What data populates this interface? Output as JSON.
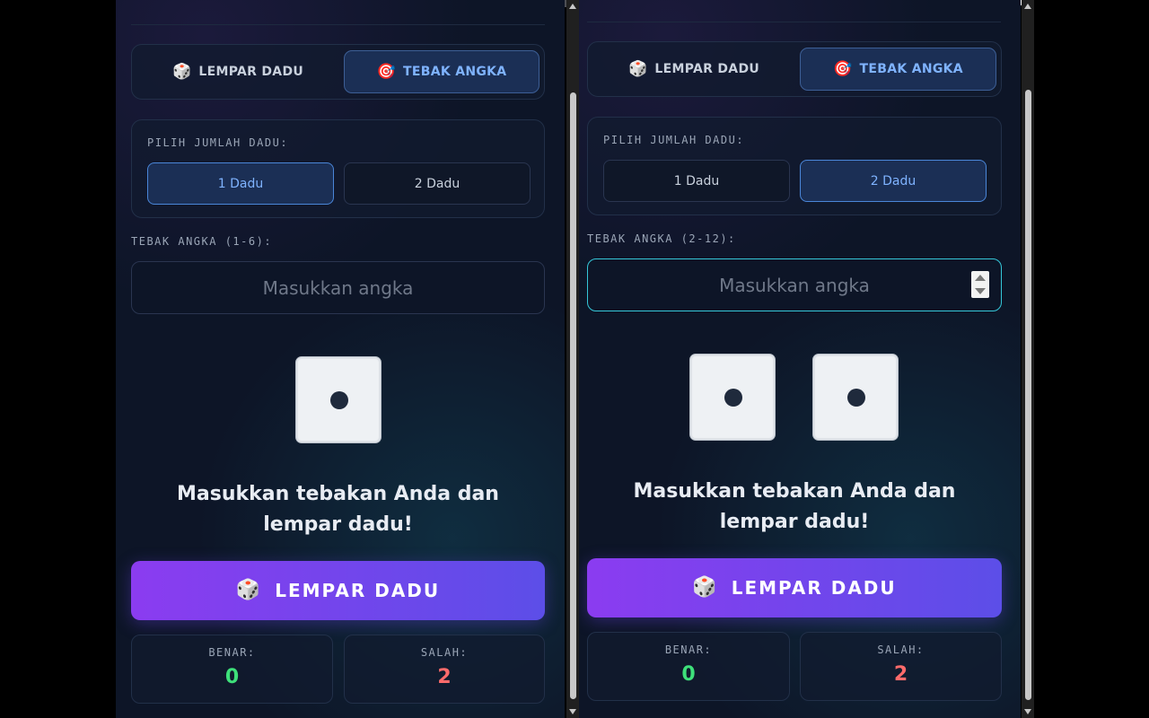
{
  "icons": {
    "dice": "🎲",
    "target": "🎯"
  },
  "colors": {
    "accent_blue": "#7fb3ff",
    "correct": "#3ee07a",
    "wrong": "#ff6b6b",
    "roll_gradient_start": "#8b3cf0",
    "roll_gradient_end": "#5c4ee8"
  },
  "left": {
    "modes": {
      "roll_label": "LEMPAR DADU",
      "guess_label": "TEBAK ANGKA",
      "active": "guess"
    },
    "dice_count": {
      "label": "PILIH JUMLAH DADU:",
      "options": [
        "1 Dadu",
        "2 Dadu"
      ],
      "selected": "1 Dadu"
    },
    "guess": {
      "label": "TEBAK ANGKA (1-6):",
      "placeholder": "Masukkan angka",
      "value": ""
    },
    "dice_faces": [
      1
    ],
    "message": "Masukkan tebakan Anda dan lempar dadu!",
    "roll_button": "LEMPAR DADU",
    "stats": {
      "correct_label": "BENAR:",
      "correct": "0",
      "wrong_label": "SALAH:",
      "wrong": "2"
    }
  },
  "right": {
    "modes": {
      "roll_label": "LEMPAR DADU",
      "guess_label": "TEBAK ANGKA",
      "active": "guess"
    },
    "dice_count": {
      "label": "PILIH JUMLAH DADU:",
      "options": [
        "1 Dadu",
        "2 Dadu"
      ],
      "selected": "2 Dadu"
    },
    "guess": {
      "label": "TEBAK ANGKA (2-12):",
      "placeholder": "Masukkan angka",
      "value": ""
    },
    "dice_faces": [
      1,
      1
    ],
    "message": "Masukkan tebakan Anda dan lempar dadu!",
    "roll_button": "LEMPAR DADU",
    "stats": {
      "correct_label": "BENAR:",
      "correct": "0",
      "wrong_label": "SALAH:",
      "wrong": "2"
    }
  }
}
